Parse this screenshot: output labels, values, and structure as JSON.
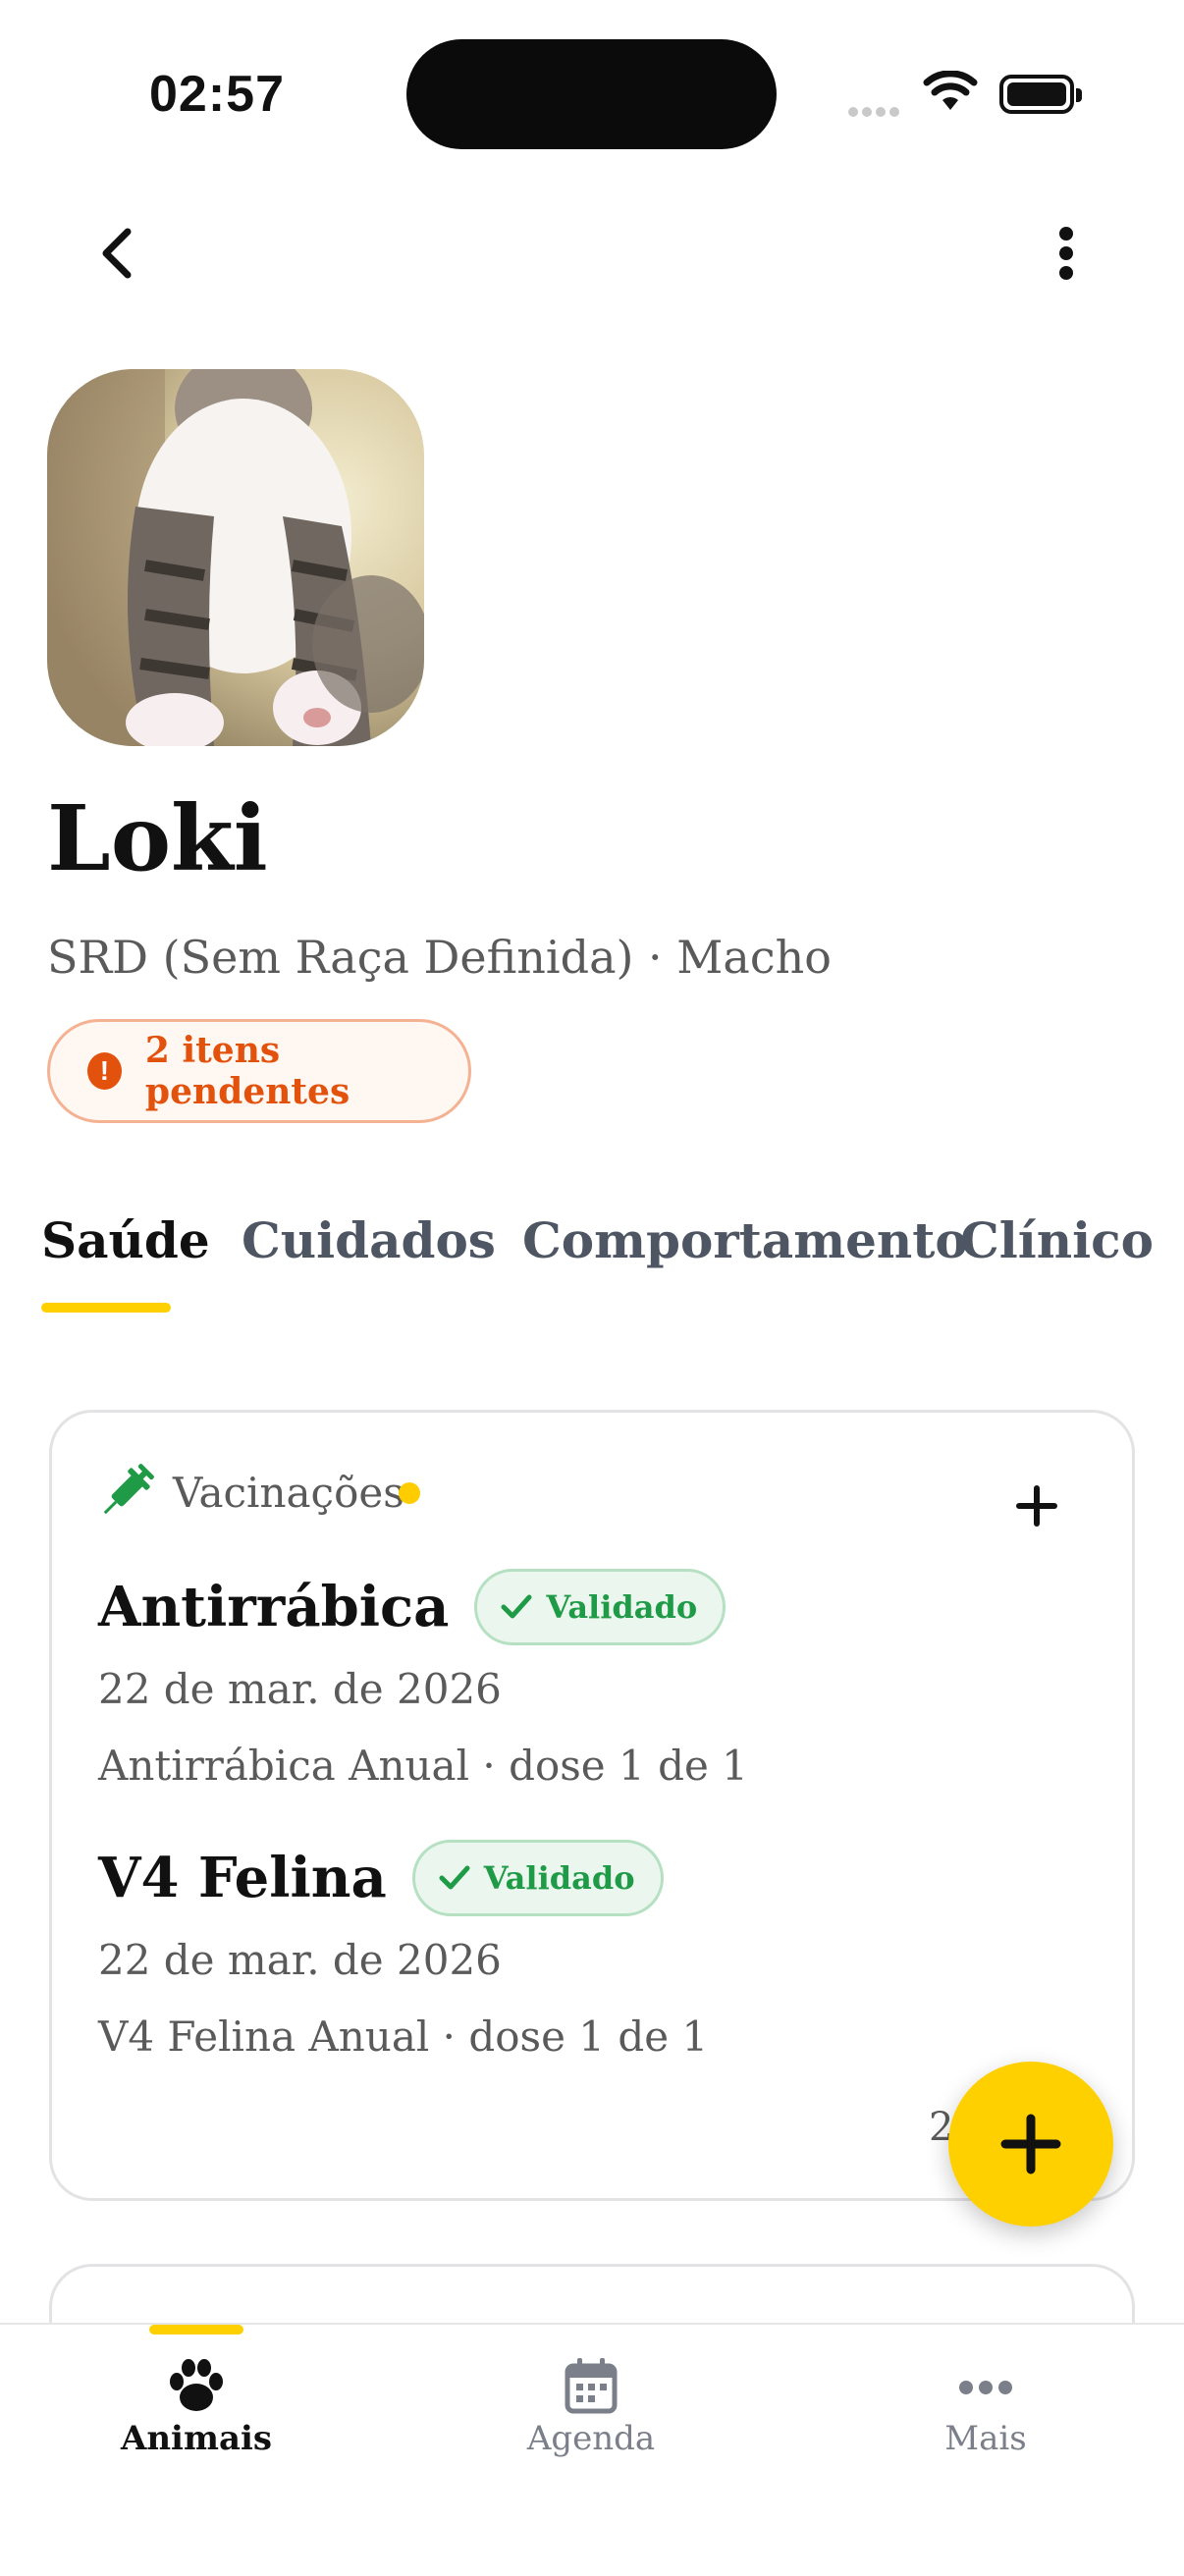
{
  "status_bar": {
    "time": "02:57"
  },
  "pet": {
    "name": "Loki",
    "subtitle": "SRD (Sem Raça Definida) · Macho",
    "pending_label": "2 itens pendentes"
  },
  "tabs": [
    {
      "label": "Saúde",
      "active": true
    },
    {
      "label": "Cuidados",
      "active": false
    },
    {
      "label": "Comportamento",
      "active": false
    },
    {
      "label": "Clínico",
      "active": false
    }
  ],
  "vaccinations": {
    "title": "Vacinações",
    "count_partial": "2",
    "items": [
      {
        "name": "Antirrábica",
        "badge": "Validado",
        "date": "22 de mar. de 2026",
        "dose": "Antirrábica Anual · dose 1 de 1"
      },
      {
        "name": "V4 Felina",
        "badge": "Validado",
        "date": "22 de mar. de 2026",
        "dose": "V4 Felina Anual · dose 1 de 1"
      }
    ]
  },
  "bottom_nav": [
    {
      "label": "Animais",
      "icon": "paw-icon",
      "active": true
    },
    {
      "label": "Agenda",
      "icon": "calendar-icon",
      "active": false
    },
    {
      "label": "Mais",
      "icon": "more-dots-icon",
      "active": false
    }
  ],
  "colors": {
    "accent": "#ffd000",
    "pending": "#e2520d",
    "validated": "#1f9a46",
    "vaccine_icon": "#1f9a46"
  }
}
